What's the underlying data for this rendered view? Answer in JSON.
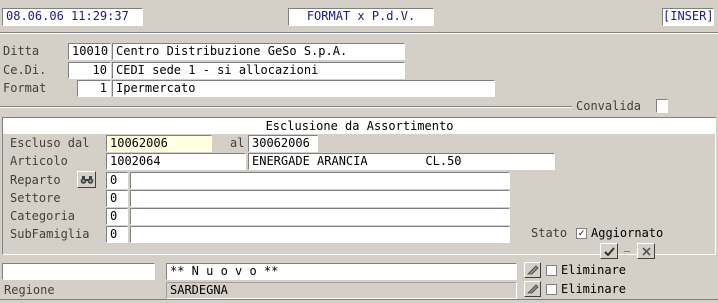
{
  "header": {
    "datetime": "08.06.06 11:29:37",
    "title": "FORMAT x P.d.V.",
    "mode": "[INSER]"
  },
  "ditta": {
    "label": "Ditta",
    "code": "10010",
    "name": "Centro Distribuzione GeSo S.p.A."
  },
  "cedi": {
    "label": "Ce.Di.",
    "code": "10",
    "name": "CEDI sede 1 - si allocazioni"
  },
  "format": {
    "label": "Format",
    "code": "1",
    "name": "Ipermercato"
  },
  "convalida": {
    "label": "Convalida",
    "checked": false
  },
  "section": {
    "title": "Esclusione da Assortimento",
    "escluso_dal_label": "Escluso dal",
    "escluso_dal": "10062006",
    "al_label": "al",
    "al": "30062006",
    "articolo_label": "Articolo",
    "articolo_code": "1002064",
    "articolo_desc": "ENERGADE ARANCIA        CL.50",
    "reparto_label": "Reparto",
    "reparto_code": "0",
    "reparto_desc": "",
    "settore_label": "Settore",
    "settore_code": "0",
    "settore_desc": "",
    "categoria_label": "Categoria",
    "categoria_code": "0",
    "categoria_desc": "",
    "subfamiglia_label": "SubFamiglia",
    "subfamiglia_code": "0",
    "subfamiglia_desc": "",
    "stato_label": "Stato",
    "stato_value": "Aggiornato",
    "stato_checked": true
  },
  "bottom": {
    "row1_left": "",
    "row1_value": "** N u o v o **",
    "row1_eliminare": "Eliminare",
    "row2_label": "Regione",
    "row2_value": "SARDEGNA",
    "row2_eliminare": "Eliminare"
  }
}
